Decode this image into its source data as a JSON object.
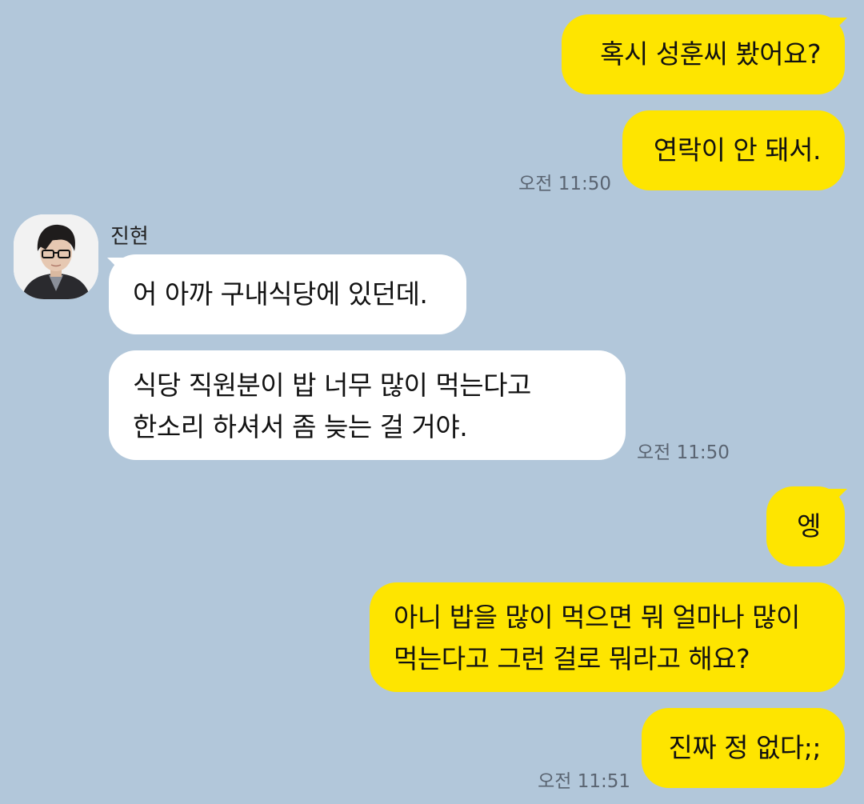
{
  "chat": {
    "msg1": "혹시 성훈씨 봤어요?",
    "msg2": "연락이 안 돼서.",
    "time1": "오전 11:50",
    "sender_name": "진현",
    "msg3": "어 아까 구내식당에 있던데.",
    "msg4": "식당 직원분이 밥 너무 많이 먹는다고\n한소리 하셔서 좀 늦는 걸 거야.",
    "time2": "오전 11:50",
    "msg5": "엥",
    "msg6": "아니 밥을 많이 먹으면 뭐 얼마나 많이\n먹는다고 그런 걸로 뭐라고 해요?",
    "msg7": "진짜 정 없다;;",
    "time3": "오전 11:51"
  },
  "colors": {
    "background": "#b2c7da",
    "my_bubble": "#fee500",
    "their_bubble": "#ffffff",
    "timestamp": "#5a6471"
  },
  "icons": {
    "avatar": "profile-photo-person-with-glasses"
  }
}
